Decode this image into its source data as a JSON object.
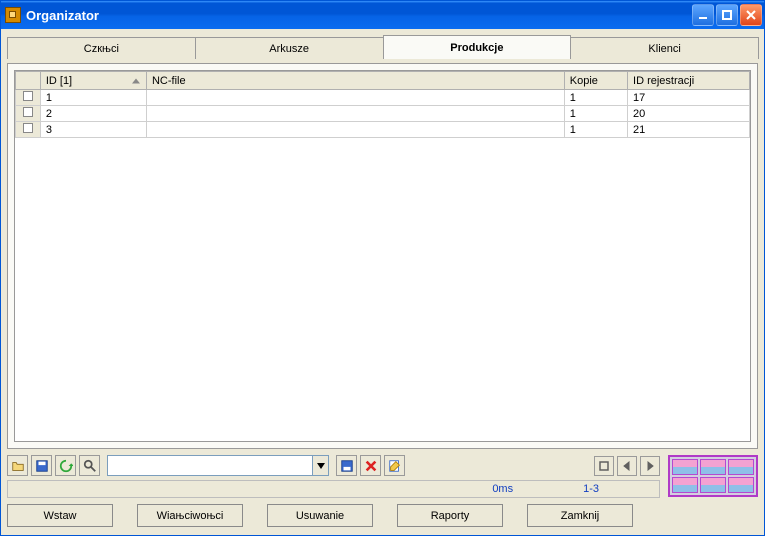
{
  "window": {
    "title": "Organizator"
  },
  "tabs": {
    "t0": "Czкњci",
    "t1": "Arkusze",
    "t2": "Produkcje",
    "t3": "Klienci",
    "activeIndex": 2
  },
  "grid": {
    "headers": {
      "rowhdr": "",
      "id": "ID [1]",
      "nc": "NC-file",
      "kopie": "Kopie",
      "reg": "ID rejestracji"
    },
    "rows": [
      {
        "id": "1",
        "nc": "",
        "kopie": "1",
        "reg": "17"
      },
      {
        "id": "2",
        "nc": "",
        "kopie": "1",
        "reg": "20"
      },
      {
        "id": "3",
        "nc": "",
        "kopie": "1",
        "reg": "21"
      }
    ]
  },
  "search": {
    "placeholder": ""
  },
  "status": {
    "time": "0ms",
    "range": "1-3"
  },
  "buttons": {
    "insert": "Wstaw",
    "props": "Wіaњciwoњci",
    "delete": "Usuwanie",
    "reports": "Raporty",
    "close": "Zamknij"
  }
}
